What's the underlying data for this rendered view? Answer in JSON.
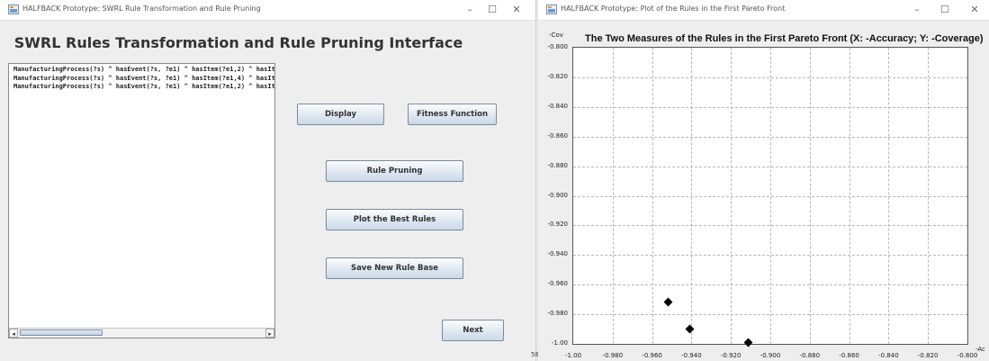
{
  "left_window": {
    "title": "HALFBACK Prototype: SWRL Rule Transformation and Rule Pruning",
    "heading": "SWRL Rules Transformation and Rule Pruning Interface",
    "rules": [
      "ManufacturingProcess(?s) ^ hasEvent(?s, ?e1) ^ hasItem(?e1,2) ^ hasIt",
      "ManufacturingProcess(?s) ^ hasEvent(?s, ?e1) ^ hasItem(?e1,4) ^ hasIt",
      "ManufacturingProcess(?s) ^ hasEvent(?s, ?e1) ^ hasItem(?e1,2) ^ hasIt"
    ],
    "buttons": {
      "display": "Display",
      "fitness": "Fitness Function",
      "pruning": "Rule Pruning",
      "plot": "Plot the Best Rules",
      "save": "Save New Rule Base",
      "next": "Next"
    },
    "controls": {
      "minimize": "–",
      "maximize": "☐",
      "close": "✕"
    },
    "scroll_left": "◂",
    "scroll_right": "▸"
  },
  "right_window": {
    "title": "HALFBACK Prototype: Plot of the Rules in the First Pareto Front",
    "controls": {
      "minimize": "–",
      "maximize": "☐",
      "close": "✕"
    }
  },
  "stray_text": "58",
  "chart_data": {
    "type": "scatter",
    "title": "The Two Measures of the Rules in the First Pareto Front (X: -Accuracy; Y: -Coverage)",
    "xlabel": "-Ac",
    "ylabel": "-Cov",
    "xlim": [
      -1.0,
      -0.8
    ],
    "ylim": [
      -1.0,
      -0.8
    ],
    "x_ticks": [
      "-1.00",
      "-0.980",
      "-0.960",
      "-0.940",
      "-0.920",
      "-0.900",
      "-0.880",
      "-0.860",
      "-0.840",
      "-0.820",
      "-0.800"
    ],
    "y_ticks": [
      "-0.800",
      "-0.820",
      "-0.840",
      "-0.860",
      "-0.880",
      "-0.900",
      "-0.920",
      "-0.940",
      "-0.960",
      "-0.980",
      "-1.00"
    ],
    "points": [
      {
        "x": -0.952,
        "y": -0.972
      },
      {
        "x": -0.941,
        "y": -0.99
      },
      {
        "x": -0.911,
        "y": -0.999
      }
    ],
    "marker": "diamond",
    "marker_color": "#000000",
    "grid": true
  }
}
